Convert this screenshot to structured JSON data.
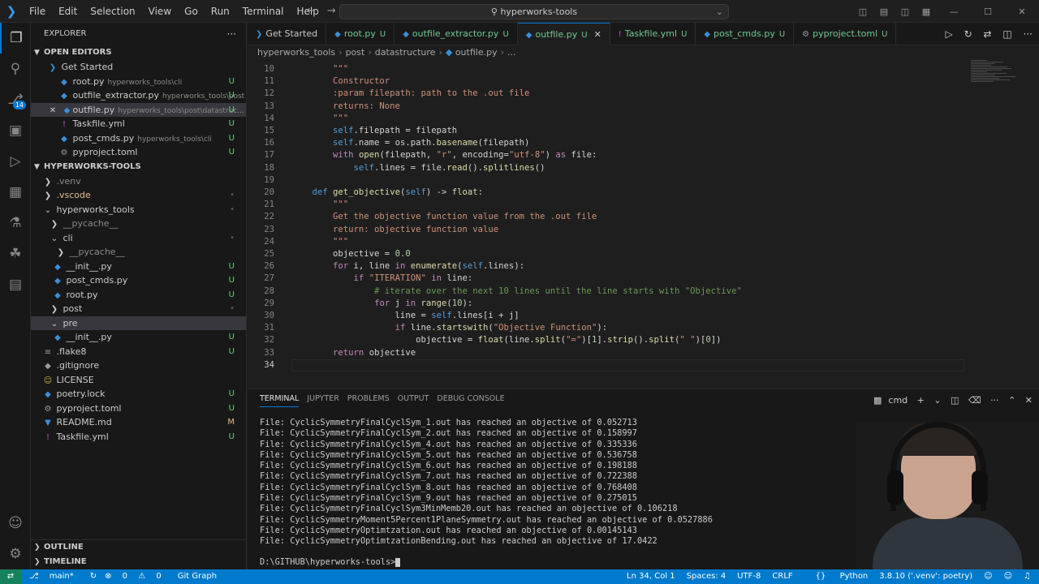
{
  "titlebar": {
    "menu": [
      "File",
      "Edit",
      "Selection",
      "View",
      "Go",
      "Run",
      "Terminal",
      "Help"
    ],
    "search_text": "hyperworks-tools"
  },
  "activity": {
    "source_control_badge": "14"
  },
  "explorer": {
    "title": "EXPLORER",
    "open_editors_label": "OPEN EDITORS",
    "open_editors": [
      {
        "name": "Get Started",
        "desc": "",
        "status": "",
        "icon": "vscode-icon"
      },
      {
        "name": "root.py",
        "desc": "hyperworks_tools\\cli",
        "status": "U",
        "icon": "python-icon"
      },
      {
        "name": "outfile_extractor.py",
        "desc": "hyperworks_tools\\post",
        "status": "U",
        "icon": "python-icon"
      },
      {
        "name": "outfile.py",
        "desc": "hyperworks_tools\\post\\datastruc...",
        "status": "U",
        "icon": "python-icon"
      },
      {
        "name": "Taskfile.yml",
        "desc": "",
        "status": "U",
        "icon": "yaml-icon"
      },
      {
        "name": "post_cmds.py",
        "desc": "hyperworks_tools\\cli",
        "status": "U",
        "icon": "python-icon"
      },
      {
        "name": "pyproject.toml",
        "desc": "",
        "status": "U",
        "icon": "toml-icon"
      }
    ],
    "project_label": "HYPERWORKS-TOOLS",
    "tree": [
      {
        "name": ".venv",
        "indent": 1,
        "type": "folder",
        "status": ""
      },
      {
        "name": ".vscode",
        "indent": 1,
        "type": "folder",
        "status": "•"
      },
      {
        "name": "hyperworks_tools",
        "indent": 1,
        "type": "folder-open",
        "status": "•"
      },
      {
        "name": "__pycache__",
        "indent": 2,
        "type": "folder",
        "status": ""
      },
      {
        "name": "cli",
        "indent": 2,
        "type": "folder-open",
        "status": "•"
      },
      {
        "name": "__pycache__",
        "indent": 3,
        "type": "folder",
        "status": ""
      },
      {
        "name": "__init__.py",
        "indent": 3,
        "type": "python",
        "status": "U"
      },
      {
        "name": "post_cmds.py",
        "indent": 3,
        "type": "python",
        "status": "U"
      },
      {
        "name": "root.py",
        "indent": 3,
        "type": "python",
        "status": "U"
      },
      {
        "name": "post",
        "indent": 2,
        "type": "folder",
        "status": "•"
      },
      {
        "name": "pre",
        "indent": 2,
        "type": "folder-open",
        "status": ""
      },
      {
        "name": "__init__.py",
        "indent": 3,
        "type": "python",
        "status": "U"
      },
      {
        "name": ".flake8",
        "indent": 1,
        "type": "config",
        "status": "U"
      },
      {
        "name": ".gitignore",
        "indent": 1,
        "type": "config",
        "status": ""
      },
      {
        "name": "LICENSE",
        "indent": 1,
        "type": "license",
        "status": ""
      },
      {
        "name": "poetry.lock",
        "indent": 1,
        "type": "lock",
        "status": "U"
      },
      {
        "name": "pyproject.toml",
        "indent": 1,
        "type": "toml",
        "status": "U"
      },
      {
        "name": "README.md",
        "indent": 1,
        "type": "markdown",
        "status": "M"
      },
      {
        "name": "Taskfile.yml",
        "indent": 1,
        "type": "yaml",
        "status": "U"
      }
    ],
    "outline_label": "OUTLINE",
    "timeline_label": "TIMELINE"
  },
  "tabs": [
    {
      "label": "Get Started",
      "status": "",
      "icon": "vscode-icon"
    },
    {
      "label": "root.py",
      "status": "U",
      "icon": "python-icon"
    },
    {
      "label": "outfile_extractor.py",
      "status": "U",
      "icon": "python-icon"
    },
    {
      "label": "outfile.py",
      "status": "U",
      "icon": "python-icon",
      "active": true
    },
    {
      "label": "Taskfile.yml",
      "status": "U",
      "icon": "yaml-icon"
    },
    {
      "label": "post_cmds.py",
      "status": "U",
      "icon": "python-icon"
    },
    {
      "label": "pyproject.toml",
      "status": "U",
      "icon": "gear-icon"
    }
  ],
  "breadcrumb": [
    "hyperworks_tools",
    "post",
    "datastructure",
    "outfile.py",
    "..."
  ],
  "code": {
    "line_numbers": [
      "10",
      "11",
      "12",
      "13",
      "14",
      "15",
      "16",
      "17",
      "18",
      "19",
      "20",
      "21",
      "22",
      "23",
      "24",
      "25",
      "26",
      "27",
      "28",
      "29",
      "30",
      "31",
      "32",
      "33",
      "34"
    ],
    "lines": [
      "        \"\"\"",
      "        Constructor",
      "        :param filepath: path to the .out file",
      "        returns: None",
      "        \"\"\"",
      "        self.filepath = filepath",
      "        self.name = os.path.basename(filepath)",
      "        with open(filepath, \"r\", encoding=\"utf-8\") as file:",
      "            self.lines = file.read().splitlines()",
      "",
      "    def get_objective(self) -> float:",
      "        \"\"\"",
      "        Get the objective function value from the .out file",
      "        return: objective function value",
      "        \"\"\"",
      "        objective = 0.0",
      "        for i, line in enumerate(self.lines):",
      "            if \"ITERATION\" in line:",
      "                # iterate over the next 10 lines until the line starts with \"Objective\"",
      "                for j in range(10):",
      "                    line = self.lines[i + j]",
      "                    if line.startswith(\"Objective Function\"):",
      "                        objective = float(line.split(\"=\")[1].strip().split(\" \")[0])",
      "        return objective",
      ""
    ]
  },
  "panel": {
    "tabs": [
      "TERMINAL",
      "JUPYTER",
      "PROBLEMS",
      "OUTPUT",
      "DEBUG CONSOLE"
    ],
    "shell": "cmd",
    "terminal_lines": [
      "File: CyclicSymmetryFinalCyclSym_1.out has reached an objective of 0.052713",
      "File: CyclicSymmetryFinalCyclSym_2.out has reached an objective of 0.158997",
      "File: CyclicSymmetryFinalCyclSym_4.out has reached an objective of 0.335336",
      "File: CyclicSymmetryFinalCyclSym_5.out has reached an objective of 0.536758",
      "File: CyclicSymmetryFinalCyclSym_6.out has reached an objective of 0.198188",
      "File: CyclicSymmetryFinalCyclSym_7.out has reached an objective of 0.722388",
      "File: CyclicSymmetryFinalCyclSym_8.out has reached an objective of 0.768408",
      "File: CyclicSymmetryFinalCyclSym_9.out has reached an objective of 0.275015",
      "File: CyclicSymmetryFinalCyclSym3MinMemb20.out has reached an objective of 0.106218",
      "File: CyclicSymmetryMoment5Percent1PlaneSymmetry.out has reached an objective of 0.0527886",
      "File: CyclicSymmetryOptimtzation.out has reached an objective of 0.00145143",
      "File: CyclicSymmetryOptimtzationBending.out has reached an objective of 17.0422"
    ],
    "prompt": "D:\\GITHUB\\hyperworks-tools>"
  },
  "statusbar": {
    "branch": "main*",
    "sync": "",
    "problems": "0",
    "warnings": "0",
    "git_graph": "Git Graph",
    "position": "Ln 34, Col 1",
    "spaces": "Spaces: 4",
    "encoding": "UTF-8",
    "eol": "CRLF",
    "language": "Python",
    "interpreter": "3.8.10 ('.venv': poetry)"
  }
}
